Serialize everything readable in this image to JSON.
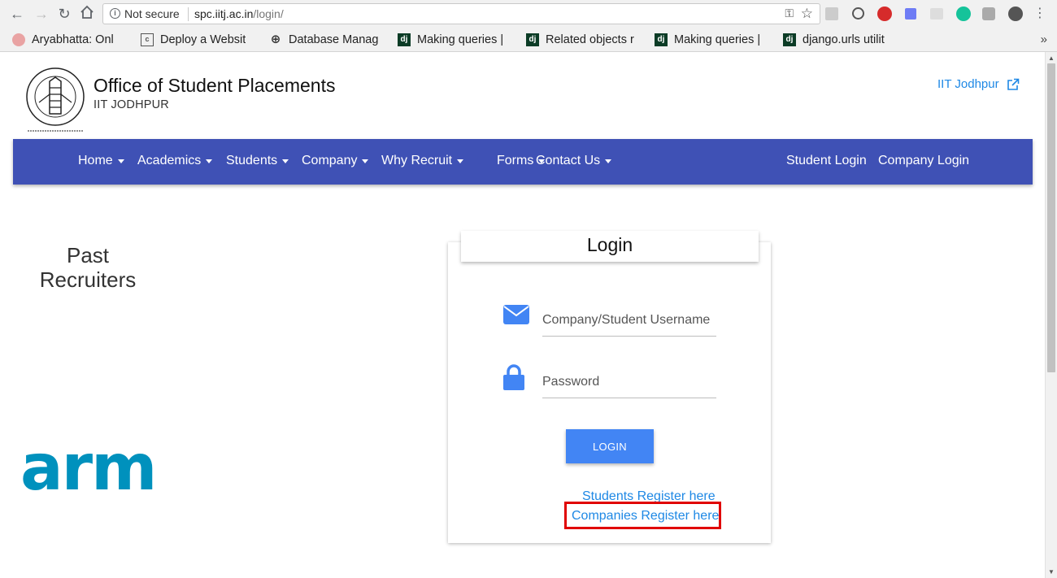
{
  "browser": {
    "security_label": "Not secure",
    "url_host": "spc.iitj.ac.in",
    "url_path": "/login/",
    "bookmarks": [
      {
        "label": "Aryabhatta: Onl",
        "favicon": "aryabhatta-icon"
      },
      {
        "label": "Deploy a Websit",
        "favicon": "deploy-icon"
      },
      {
        "label": "Database Manag",
        "favicon": "globe-icon"
      },
      {
        "label": "Making queries |",
        "favicon": "dj"
      },
      {
        "label": "Related objects r",
        "favicon": "dj"
      },
      {
        "label": "Making queries |",
        "favicon": "dj"
      },
      {
        "label": "django.urls utilit",
        "favicon": "dj"
      }
    ],
    "bookmarks_more": "»"
  },
  "header": {
    "title": "Office of Student Placements",
    "subtitle": "IIT JODHPUR",
    "external_link": "IIT Jodhpur"
  },
  "navbar": {
    "items": [
      "Home",
      "Academics",
      "Students",
      "Company",
      "Why Recruit",
      "Forms",
      "Contact Us"
    ],
    "right_items": [
      "Student Login",
      "Company Login"
    ]
  },
  "sidebar": {
    "heading": "Past Recruiters",
    "logo_text": "arm"
  },
  "login": {
    "title": "Login",
    "username_placeholder": "Company/Student Username",
    "password_placeholder": "Password",
    "button_label": "LOGIN",
    "students_register": "Students Register here",
    "companies_register": "Companies Register here"
  },
  "colors": {
    "navbar": "#3f51b5",
    "accent": "#4285f4",
    "link": "#1e88e5",
    "highlight": "#e00000",
    "arm": "#0091bd"
  }
}
